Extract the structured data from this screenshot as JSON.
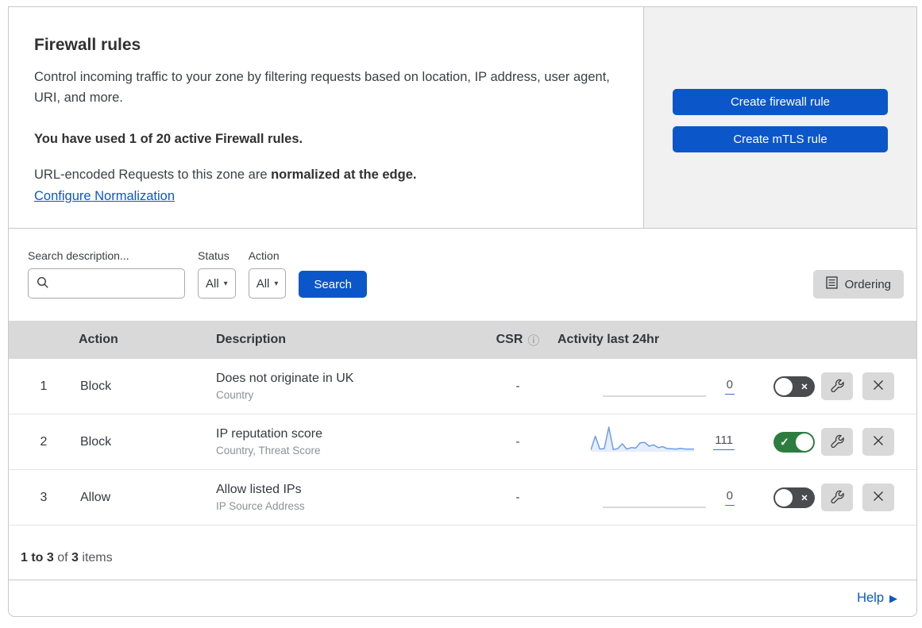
{
  "header": {
    "title": "Firewall rules",
    "description": "Control incoming traffic to your zone by filtering requests based on location, IP address, user agent, URI, and more.",
    "usage_note": "You have used 1 of 20 active Firewall rules.",
    "normalization_prefix": "URL-encoded Requests to this zone are ",
    "normalization_bold": "normalized at the edge.",
    "normalization_link": "Configure Normalization",
    "create_firewall_rule_label": "Create firewall rule",
    "create_mtls_rule_label": "Create mTLS rule"
  },
  "filters": {
    "search_label": "Search description...",
    "search_value": "",
    "status_label": "Status",
    "status_value": "All",
    "action_label": "Action",
    "action_value": "All",
    "search_button_label": "Search",
    "ordering_button_label": "Ordering"
  },
  "table": {
    "headers": {
      "action": "Action",
      "description": "Description",
      "csr": "CSR",
      "activity": "Activity last 24hr"
    },
    "rows": [
      {
        "priority": "1",
        "action": "Block",
        "description": "Does not originate in UK",
        "match_fields": "Country",
        "csr": "-",
        "activity_count": "0",
        "enabled": false,
        "sparkline": [
          0,
          0,
          0,
          0,
          0,
          0,
          0,
          0,
          0,
          0,
          0,
          0,
          0,
          0,
          0,
          0,
          0,
          0,
          0,
          0,
          0,
          0,
          0,
          0
        ]
      },
      {
        "priority": "2",
        "action": "Block",
        "description": "IP reputation score",
        "match_fields": "Country, Threat Score",
        "csr": "-",
        "activity_count": "111",
        "enabled": true,
        "sparkline": [
          4,
          62,
          8,
          10,
          100,
          6,
          10,
          30,
          8,
          14,
          12,
          34,
          36,
          20,
          26,
          14,
          18,
          10,
          9,
          8,
          11,
          8,
          8,
          8
        ]
      },
      {
        "priority": "3",
        "action": "Allow",
        "description": "Allow listed IPs",
        "match_fields": "IP Source Address",
        "csr": "-",
        "activity_count": "0",
        "enabled": false,
        "sparkline": [
          0,
          0,
          0,
          0,
          0,
          0,
          0,
          0,
          0,
          0,
          0,
          0,
          0,
          0,
          0,
          0,
          0,
          0,
          0,
          0,
          0,
          0,
          0,
          0
        ]
      }
    ]
  },
  "footer": {
    "range": "1 to 3",
    "of": " of ",
    "total": "3",
    "items": " items"
  },
  "help": {
    "label": "Help"
  },
  "colors": {
    "accent_blue": "#0b57c9",
    "toggle_on_green": "#2e7d40",
    "toggle_off_gray": "#494b4f",
    "sparkline_blue": "#6d9de8",
    "panel_gray": "#f1f1f2",
    "table_header_gray": "#d9d9d9"
  }
}
